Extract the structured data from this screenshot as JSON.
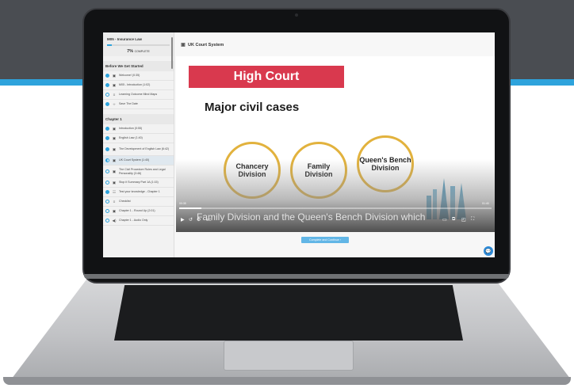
{
  "sidebar": {
    "course_title": "M05 - Insurance Law",
    "progress_percent": 7,
    "progress_value": "7%",
    "progress_label": "COMPLETE",
    "sections": [
      {
        "title": "Before We Get Started",
        "items": [
          {
            "label": "Welcome! (0:35)",
            "icon": "video-icon",
            "status": "done"
          },
          {
            "label": "M05 - Introduction (1:02)",
            "icon": "video-icon",
            "status": "done"
          },
          {
            "label": "Learning Outcome Mind Maps",
            "icon": "list-icon",
            "status": "none"
          },
          {
            "label": "Save The Date",
            "icon": "code-icon",
            "status": "done"
          }
        ]
      },
      {
        "title": "Chapter 1",
        "items": [
          {
            "label": "Introduction (0:55)",
            "icon": "video-icon",
            "status": "done"
          },
          {
            "label": "English Law (1:40)",
            "icon": "video-icon",
            "status": "done"
          },
          {
            "label": "The Development of English Law (6:42)",
            "icon": "video-icon",
            "status": "done"
          },
          {
            "label": "UK Court System (1:40)",
            "icon": "video-icon",
            "status": "current"
          },
          {
            "label": "The Civil Procedure Rules and Legal Personality (3:46)",
            "icon": "video-icon",
            "status": "none"
          },
          {
            "label": "Stop it Summary Part 1A (1:15)",
            "icon": "video-icon",
            "status": "none"
          },
          {
            "label": "Test your knowledge - Chapter 1",
            "icon": "quiz-icon",
            "status": "done"
          },
          {
            "label": "Checklist",
            "icon": "list-icon",
            "status": "none"
          },
          {
            "label": "Chapter 1 - Round Up (2:01)",
            "icon": "video-icon",
            "status": "none"
          },
          {
            "label": "Chapter 1 - Audio Only",
            "icon": "audio-icon",
            "status": "none"
          }
        ]
      }
    ]
  },
  "lesson": {
    "title": "UK Court System"
  },
  "video": {
    "banner": "High Court",
    "subheading": "Major civil cases",
    "divisions": [
      "Chancery Division",
      "Family Division",
      "Queen's Bench Division"
    ],
    "caption": "Family Division and the Queen's Bench Division which",
    "time_elapsed": "00:35",
    "time_remaining": "01:40",
    "progress_fraction": 0.07,
    "controls": {
      "play": "▶",
      "rewind": "↺",
      "settings": "⚙",
      "cc": "CC",
      "captions_right": "▭",
      "airplay": "⧉",
      "pip": "◰",
      "fullscreen": "⛶"
    }
  },
  "footer": {
    "continue_label": "Complete and Continue  ›"
  },
  "chat": {
    "icon": "💬"
  },
  "colors": {
    "accent": "#2ea3dc",
    "banner_red": "#d9394e",
    "circle_gold": "#e2b23d",
    "background_dark": "#4a4d52"
  }
}
